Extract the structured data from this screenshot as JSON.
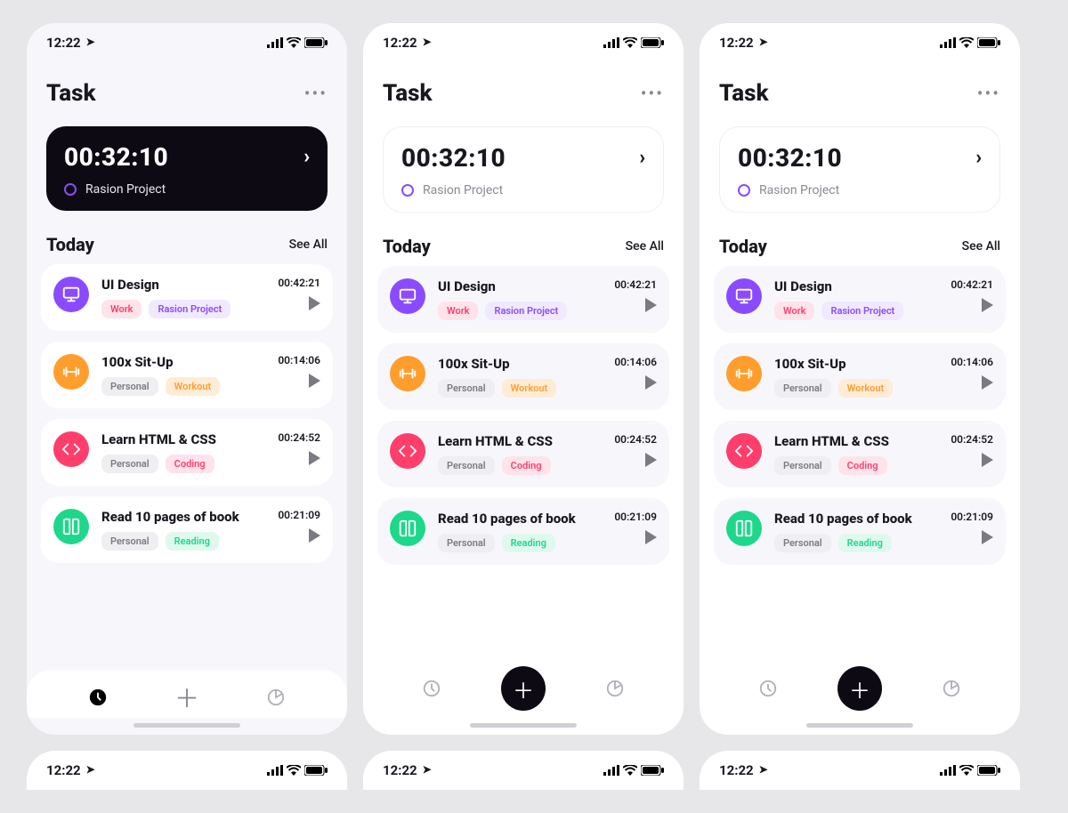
{
  "status": {
    "time": "12:22"
  },
  "header": {
    "title": "Task"
  },
  "timer": {
    "time": "00:32:10",
    "project_label": "Rasion Project"
  },
  "today": {
    "heading": "Today",
    "see_all": "See All",
    "tasks": [
      {
        "title": "UI Design",
        "time": "00:42:21",
        "icon": "monitor",
        "color": "purple",
        "tags": [
          {
            "label": "Work",
            "style": "pink"
          },
          {
            "label": "Rasion Project",
            "style": "purple"
          }
        ]
      },
      {
        "title": "100x Sit-Up",
        "time": "00:14:06",
        "icon": "dumbbell",
        "color": "orange",
        "tags": [
          {
            "label": "Personal",
            "style": "gray"
          },
          {
            "label": "Workout",
            "style": "orange"
          }
        ]
      },
      {
        "title": "Learn HTML & CSS",
        "time": "00:24:52",
        "icon": "code",
        "color": "pink",
        "tags": [
          {
            "label": "Personal",
            "style": "gray"
          },
          {
            "label": "Coding",
            "style": "pink"
          }
        ]
      },
      {
        "title": "Read 10 pages of book",
        "time": "00:21:09",
        "icon": "book",
        "color": "green",
        "tags": [
          {
            "label": "Personal",
            "style": "gray"
          },
          {
            "label": "Reading",
            "style": "green"
          }
        ]
      }
    ]
  },
  "colors": {
    "purple": "#8a4bff",
    "orange": "#ff9e2c",
    "pink": "#ff3e6c",
    "green": "#1dd88a"
  }
}
